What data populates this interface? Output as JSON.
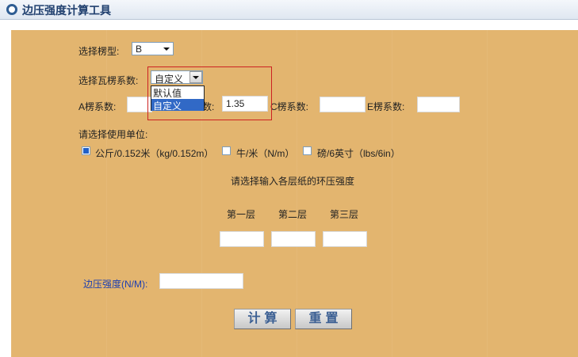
{
  "app": {
    "title": "边压强度计算工具"
  },
  "flute": {
    "label": "选择楞型:",
    "selected": "B"
  },
  "coef_select": {
    "label": "选择瓦楞系数:",
    "selected": "自定义",
    "options": [
      "默认值",
      "自定义"
    ],
    "highlighted": "自定义"
  },
  "coefficients": {
    "a_label": "A楞系数:",
    "b_label_partial": "数:",
    "b_value": "1.35",
    "c_label": "C楞系数:",
    "e_label": "E楞系数:"
  },
  "units": {
    "label": "请选择使用单位:",
    "options": [
      {
        "label": "公斤/0.152米（kg/0.152m）",
        "checked": true
      },
      {
        "label": "牛/米（N/m）",
        "checked": false
      },
      {
        "label": "磅/6英寸（lbs/6in）",
        "checked": false
      }
    ]
  },
  "layers": {
    "prompt": "请选择输入各层纸的环压强度",
    "headers": [
      "第一层",
      "第二层",
      "第三层"
    ]
  },
  "result": {
    "label": "边压强度(N/M):"
  },
  "buttons": {
    "calc": "计算",
    "reset": "重置"
  }
}
